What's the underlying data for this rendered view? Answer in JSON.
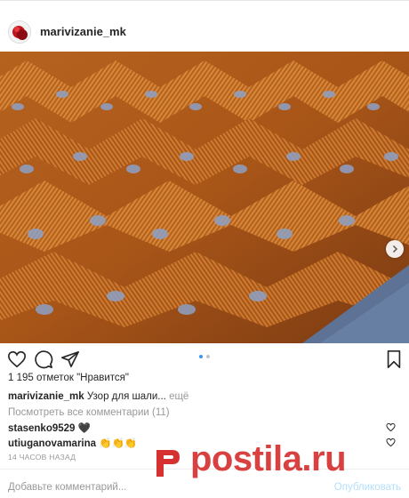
{
  "post": {
    "username": "marivizanie_mk",
    "likes_text": "1 195 отметок \"Нравится\"",
    "caption_user": "marivizanie_mk",
    "caption_text": "Узор для шали...",
    "caption_more": "ещё",
    "view_all_comments": "Посмотреть все комментарии (11)",
    "comments": [
      {
        "user": "stasenko9529",
        "text": "🖤"
      },
      {
        "user": "utiuganovamarina",
        "text": "👏👏👏"
      }
    ],
    "timestamp": "14 ЧАСОВ НАЗАД",
    "add_comment_placeholder": "Добавьте комментарий...",
    "publish_label": "Опубликовать",
    "carousel": {
      "current": 1,
      "total": 2
    }
  },
  "watermark": {
    "text": "postila.ru"
  },
  "colors": {
    "accent": "#3897f0",
    "watermark": "#d63131",
    "knit_orange": "#c8702a",
    "knit_blue": "#7f93b8"
  },
  "icons": [
    "avatar",
    "heart-icon",
    "comment-icon",
    "share-icon",
    "bookmark-icon",
    "chevron-right-icon",
    "small-heart-icon"
  ]
}
